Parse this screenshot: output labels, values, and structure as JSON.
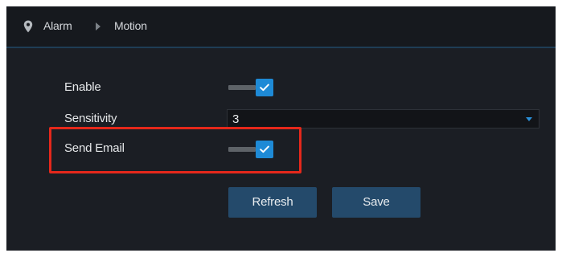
{
  "breadcrumb": {
    "items": [
      "Alarm",
      "Motion"
    ],
    "location_icon": "map-pin-icon",
    "separator_icon": "triangle-right-icon"
  },
  "form": {
    "enable": {
      "label": "Enable",
      "checked": true
    },
    "sensitivity": {
      "label": "Sensitivity",
      "value": "3"
    },
    "send_email": {
      "label": "Send Email",
      "checked": true
    }
  },
  "buttons": {
    "refresh": "Refresh",
    "save": "Save"
  },
  "colors": {
    "background": "#1b1e24",
    "header": "#16191e",
    "accent": "#1e8ad6",
    "button": "#244a6b",
    "highlight": "#e5281b"
  }
}
